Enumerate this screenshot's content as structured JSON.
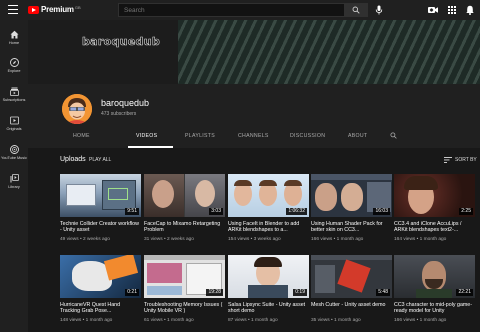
{
  "header": {
    "logo_text": "Premium",
    "region": "GB",
    "search_placeholder": "Search"
  },
  "sidebar": {
    "items": [
      {
        "label": "Home"
      },
      {
        "label": "Explore"
      },
      {
        "label": "Subscriptions"
      },
      {
        "label": "Originals"
      },
      {
        "label": "YouTube Music"
      },
      {
        "label": "Library"
      }
    ]
  },
  "banner": {
    "title": "baroquedub"
  },
  "channel": {
    "name": "baroquedub",
    "subscribers": "473 subscribers"
  },
  "tabs": [
    {
      "label": "HOME"
    },
    {
      "label": "VIDEOS"
    },
    {
      "label": "PLAYLISTS"
    },
    {
      "label": "CHANNELS"
    },
    {
      "label": "DISCUSSION"
    },
    {
      "label": "ABOUT"
    }
  ],
  "section": {
    "title": "Uploads",
    "play_all": "PLAY ALL",
    "sort_by": "SORT BY"
  },
  "videos": [
    {
      "title": "Technie Collider Creator workflow - Unity asset",
      "meta": "49 views • 2 weeks ago",
      "duration": "9:51"
    },
    {
      "title": "FaceCap to Mixamo Retargeting Problem",
      "meta": "31 views • 2 weeks ago",
      "duration": "3:03"
    },
    {
      "title": "Using FaceIt in Blender to add ARKit blendshapes to a...",
      "meta": "154 views • 3 weeks ago",
      "duration": "1:06:32"
    },
    {
      "title": "Using Human Shader Pack for better skin on CC3...",
      "meta": "166 views • 1 month ago",
      "duration": "16:03"
    },
    {
      "title": "CC3.4 and iClone AccuLips / ARKit blendshapes text2-...",
      "meta": "164 views • 1 month ago",
      "duration": "2:25"
    },
    {
      "title": "HurricaneVR Quest Hand Tracking Grab Pose...",
      "meta": "148 views • 1 month ago",
      "duration": "0:21"
    },
    {
      "title": "Troubleshooting Memory Issues ( Unity Mobile VR )",
      "meta": "61 views • 1 month ago",
      "duration": "19:28"
    },
    {
      "title": "Salsa Lipsync Suite - Unity asset short demo",
      "meta": "87 views • 1 month ago",
      "duration": "0:19"
    },
    {
      "title": "Mesh Cutter - Unity asset demo",
      "meta": "35 views • 1 month ago",
      "duration": "5:48"
    },
    {
      "title": "CC3 character to mid-poly game-ready model for Unity",
      "meta": "166 views • 1 month ago",
      "duration": "22:21"
    }
  ],
  "colors": {
    "brand_red": "#ff0000",
    "background": "#181818",
    "surface": "#202020"
  }
}
